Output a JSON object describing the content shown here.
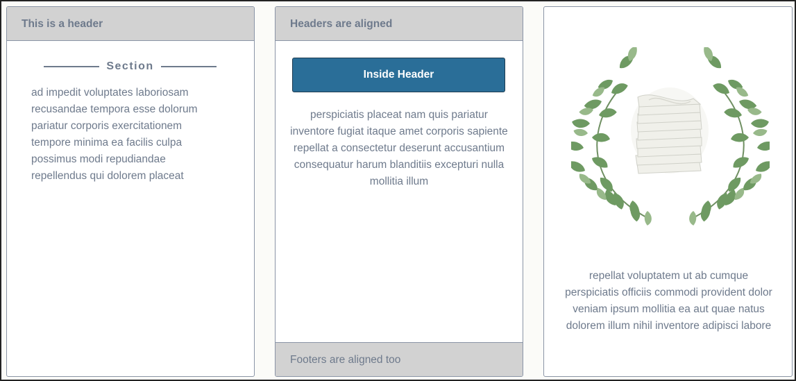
{
  "cards": [
    {
      "header": "This is a header",
      "section_label": "Section",
      "text": "ad impedit voluptates laboriosam recusandae tempora esse dolorum pariatur corporis exercitationem tempore minima ea facilis culpa possimus modi repudiandae repellendus qui dolorem placeat"
    },
    {
      "header": "Headers are aligned",
      "button_label": "Inside Header",
      "text": "perspiciatis placeat nam quis pariatur inventore fugiat itaque amet corporis sapiente repellat a consectetur deserunt accusantium consequatur harum blanditiis excepturi nulla mollitia illum",
      "footer": "Footers are aligned too"
    },
    {
      "image_icon": "laurel-wreath-papers-icon",
      "text": "repellat voluptatem ut ab cumque perspiciatis officiis commodi provident dolor veniam ipsum mollitia ea aut quae natus dolorem illum nihil inventore adipisci labore"
    }
  ],
  "colors": {
    "header_bg": "#d2d2d2",
    "text": "#6e7a8c",
    "button_bg": "#2a6e98",
    "border": "#8a94a6",
    "leaf_dark": "#5f8a58",
    "leaf_light": "#8fb47f"
  }
}
